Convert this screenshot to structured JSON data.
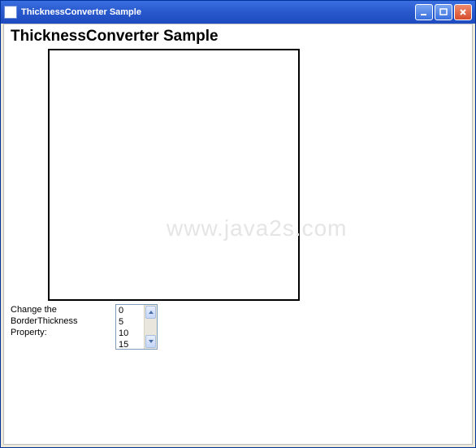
{
  "window": {
    "title": "ThicknessConverter Sample"
  },
  "content": {
    "heading": "ThicknessConverter Sample",
    "controlLabelLine1": "Change the",
    "controlLabelLine2": "BorderThickness",
    "controlLabelLine3": "Property:"
  },
  "listbox": {
    "items": [
      "0",
      "5",
      "10",
      "15"
    ]
  },
  "watermark": "www.java2s.com"
}
